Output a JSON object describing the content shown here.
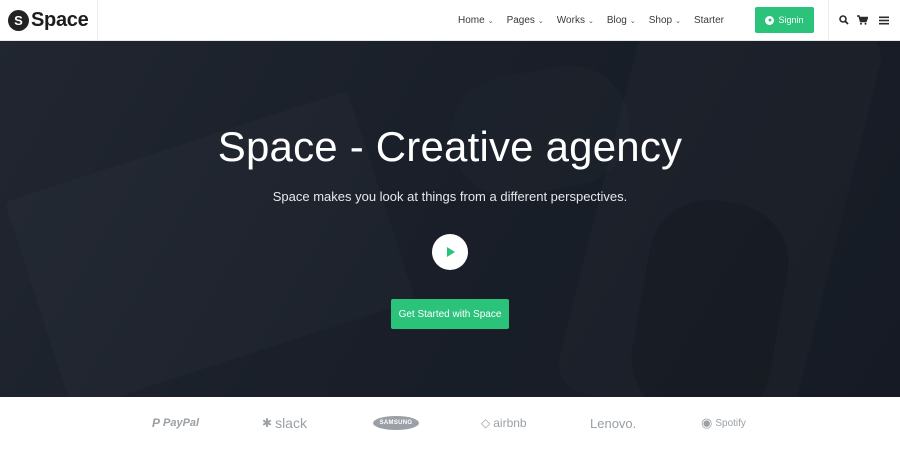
{
  "brand": {
    "initial": "S",
    "name": "Space"
  },
  "nav": {
    "items": [
      {
        "label": "Home",
        "has_dropdown": true
      },
      {
        "label": "Pages",
        "has_dropdown": true
      },
      {
        "label": "Works",
        "has_dropdown": true
      },
      {
        "label": "Blog",
        "has_dropdown": true
      },
      {
        "label": "Shop",
        "has_dropdown": true
      },
      {
        "label": "Starter",
        "has_dropdown": false
      }
    ],
    "signin_label": "Signin",
    "icons": [
      "search-icon",
      "cart-icon",
      "menu-icon"
    ]
  },
  "hero": {
    "title": "Space - Creative agency",
    "subtitle": "Space makes you look at things from a different perspectives.",
    "cta_label": "Get Started with Space"
  },
  "brands": [
    {
      "name": "PayPal"
    },
    {
      "name": "slack"
    },
    {
      "name": "SAMSUNG"
    },
    {
      "name": "airbnb"
    },
    {
      "name": "Lenovo."
    },
    {
      "name": "Spotify"
    }
  ],
  "colors": {
    "accent": "#2bc27a",
    "hero_bg": "#1f2530",
    "brand_gray": "#9aa0a6"
  }
}
